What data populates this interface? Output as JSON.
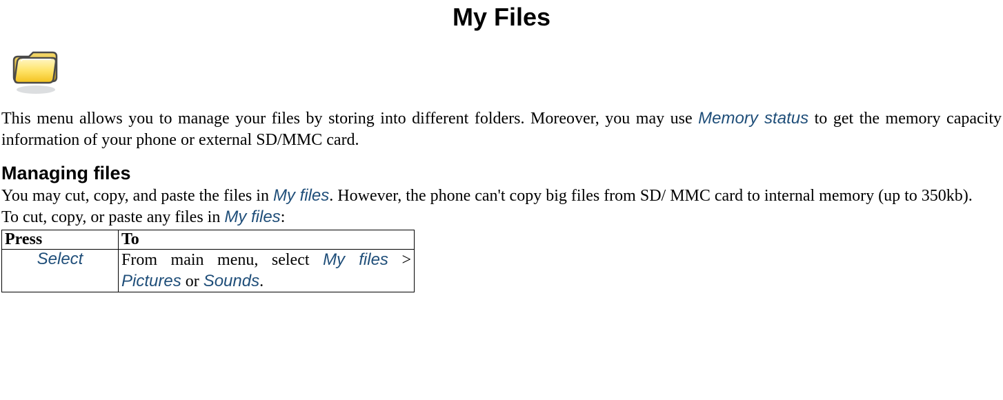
{
  "title": "My Files",
  "icon_name": "folder-icon",
  "intro": {
    "part1": "This menu allows you to manage your files by storing into different folders. Moreover, you may use ",
    "keyword": "Memory status",
    "part2": " to get the memory capacity information of your phone or external SD/MMC card."
  },
  "section": {
    "heading": "Managing files",
    "p1": {
      "part1": "You may cut, copy, and paste the files in ",
      "kw1": "My files",
      "part2": ". However, the phone can't copy big files from SD/ MMC card to internal memory (up to 350kb)."
    },
    "p2": {
      "part1": "To cut, copy, or paste any files in ",
      "kw1": "My files",
      "part2": ":"
    }
  },
  "table": {
    "headers": {
      "press": "Press",
      "to": "To"
    },
    "row1": {
      "press": "Select",
      "to_part1": "From main menu, select ",
      "to_kw1": "My files",
      "to_sep": " > ",
      "to_kw2": "Pictures",
      "to_or": " or ",
      "to_kw3": "Sounds",
      "to_end": "."
    }
  }
}
